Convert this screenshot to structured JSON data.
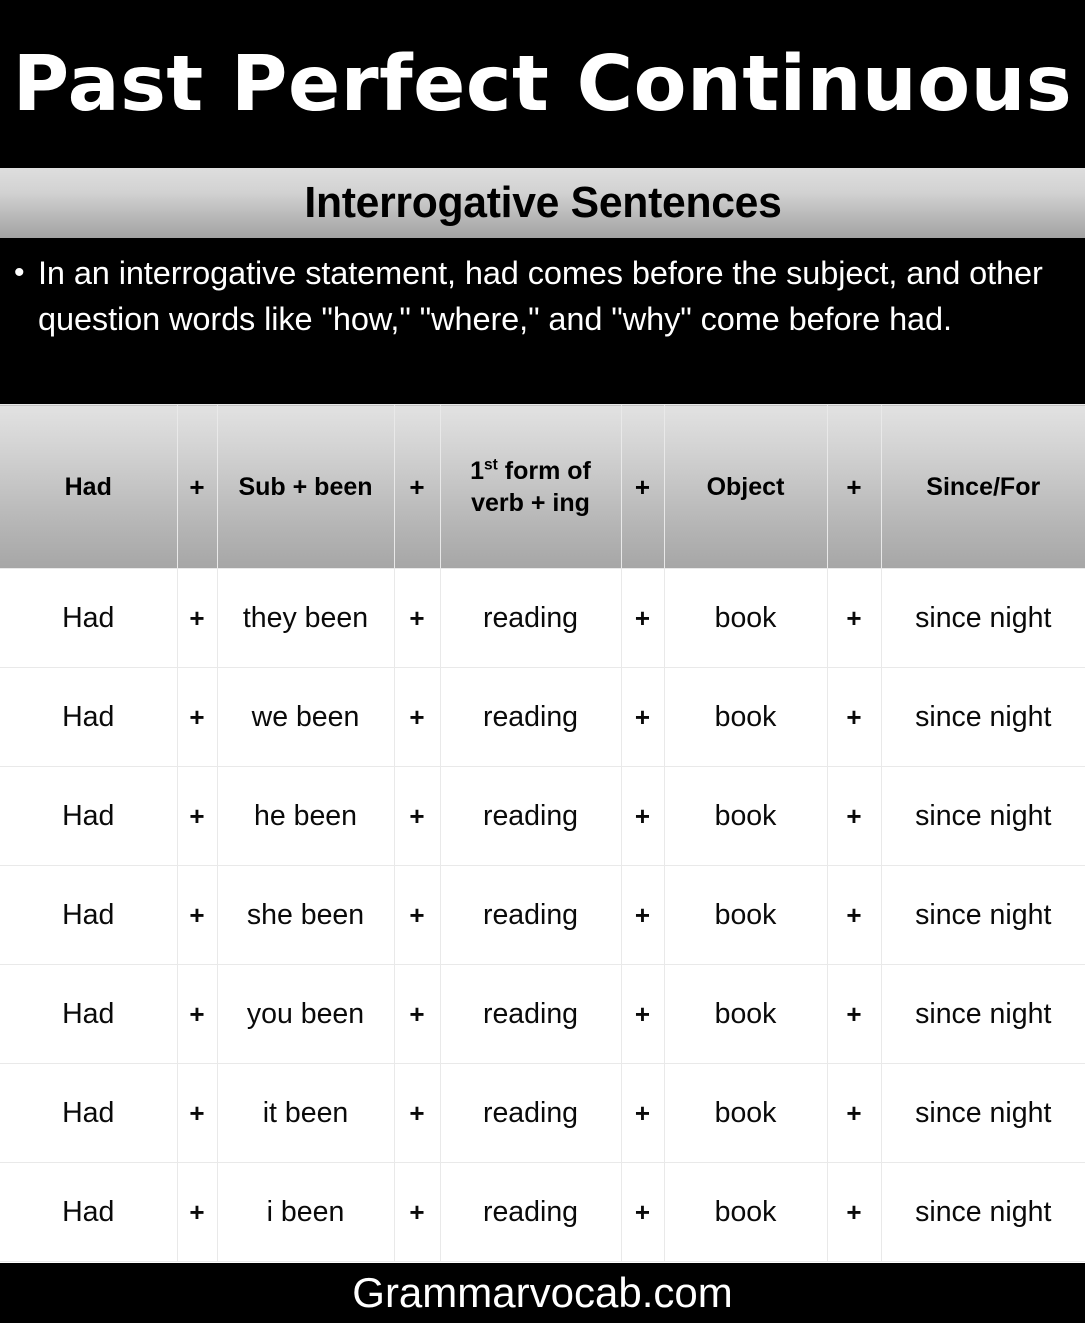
{
  "header": {
    "title": "Past Perfect Continuous",
    "subtitle": "Interrogative Sentences"
  },
  "description": {
    "bullet_glyph": "•",
    "text": "In an interrogative statement, had comes before the subject, and other question words like \"how,\" \"where,\" and \"why\" come before had."
  },
  "table": {
    "columns": [
      {
        "label": "Had",
        "key": "had"
      },
      {
        "label": "+",
        "key": "plus1"
      },
      {
        "label": "Sub + been",
        "key": "sub"
      },
      {
        "label": "+",
        "key": "plus2"
      },
      {
        "label": "1st form of verb + ing",
        "key": "verb",
        "label_pre": "1",
        "label_sup": "st",
        "label_post": " form of verb + ing"
      },
      {
        "label": "+",
        "key": "plus3"
      },
      {
        "label": "Object",
        "key": "object"
      },
      {
        "label": "+",
        "key": "plus4"
      },
      {
        "label": "Since/For",
        "key": "since"
      }
    ],
    "rows": [
      {
        "had": "Had",
        "plus1": "+",
        "sub": "they been",
        "plus2": "+",
        "verb": "reading",
        "plus3": "+",
        "object": "book",
        "plus4": "+",
        "since": "since night"
      },
      {
        "had": "Had",
        "plus1": "+",
        "sub": "we been",
        "plus2": "+",
        "verb": "reading",
        "plus3": "+",
        "object": "book",
        "plus4": "+",
        "since": "since night"
      },
      {
        "had": "Had",
        "plus1": "+",
        "sub": "he been",
        "plus2": "+",
        "verb": "reading",
        "plus3": "+",
        "object": "book",
        "plus4": "+",
        "since": "since night"
      },
      {
        "had": "Had",
        "plus1": "+",
        "sub": "she been",
        "plus2": "+",
        "verb": "reading",
        "plus3": "+",
        "object": "book",
        "plus4": "+",
        "since": "since night"
      },
      {
        "had": "Had",
        "plus1": "+",
        "sub": "you been",
        "plus2": "+",
        "verb": "reading",
        "plus3": "+",
        "object": "book",
        "plus4": "+",
        "since": "since night"
      },
      {
        "had": "Had",
        "plus1": "+",
        "sub": "it been",
        "plus2": "+",
        "verb": "reading",
        "plus3": "+",
        "object": "book",
        "plus4": "+",
        "since": "since night"
      },
      {
        "had": "Had",
        "plus1": "+",
        "sub": "i been",
        "plus2": "+",
        "verb": "reading",
        "plus3": "+",
        "object": "book",
        "plus4": "+",
        "since": "since night"
      }
    ]
  },
  "footer": {
    "site": "Grammarvocab.com"
  },
  "colors": {
    "band_black": "#000000",
    "band_text_white": "#ffffff",
    "gradient_top": "#dedede",
    "gradient_bottom": "#a3a3a3",
    "grid_line": "#e9e9e9",
    "cell_text": "#0a0a0a"
  }
}
